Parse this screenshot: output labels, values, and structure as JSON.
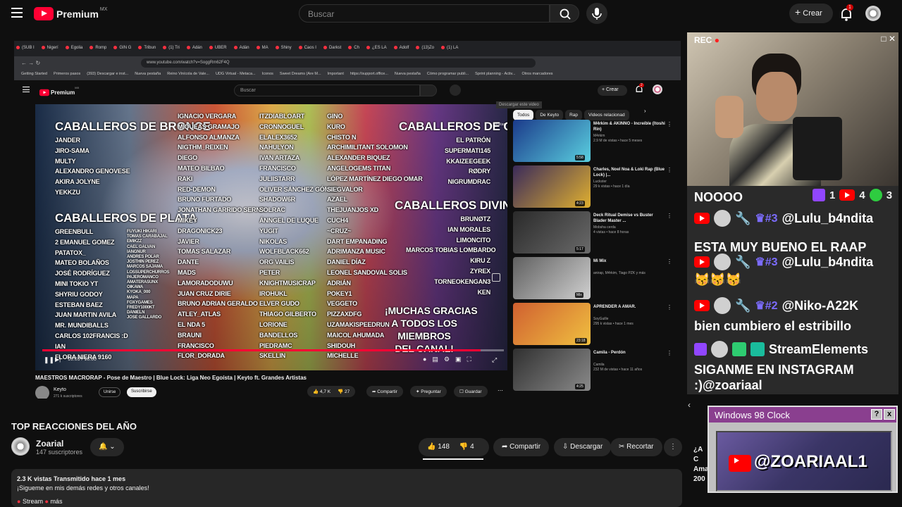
{
  "topbar": {
    "brand": "Premium",
    "region": "MX",
    "search_placeholder": "Buscar",
    "create_label": "Crear",
    "notif_count": "1"
  },
  "browser": {
    "tabs": [
      "(SUB I",
      "Nigerí",
      "Egolia",
      "Romp",
      "GIN G",
      "Tribun",
      "(1) Tri",
      "Adán",
      "UBER",
      "Adán",
      "MA",
      "Shiny",
      "Caos I",
      "Darkst",
      "Ch",
      "¿ES LA",
      "Adolf",
      "(13)Zo",
      "(1) LA"
    ],
    "url": "www.youtube.com/watch?v=SoggRm62F4Q",
    "bookmarks": [
      "Getting Started",
      "Primeros pasos",
      "(393) Descargar e inst...",
      "Nueva pestaña",
      "Reino Vinícola de Vale...",
      "UDG Virtual - Metaca...",
      "Iconos",
      "Sweet Dreams (Are M...",
      "Important",
      "https://support.office...",
      "Nueva pestaña",
      "Cómo programar publi...",
      "Sprint planning - Activ...",
      "Otros marcadores"
    ]
  },
  "inner": {
    "brand": "Premium",
    "region": "MX",
    "search_placeholder": "Buscar",
    "create_label": "Crear",
    "notif": "2",
    "video_title": "MAESTROS MACRORAP - Pose de Maestro | Blue Lock: Liga Neo Egoísta | Keyto ft. Grandes Artistas",
    "channel": "Keyto",
    "subs": "271 k suscriptores",
    "join": "Unirse",
    "subscribe": "Suscribirse",
    "likes": "4,7 K",
    "dislikes": "27",
    "share": "Compartir",
    "ask": "Preguntar",
    "save": "Guardar",
    "time": "16:03 / 18:00",
    "progress": 0.95,
    "chips": [
      "Todos",
      "De Keyto",
      "Rap",
      "Videos relacionad"
    ],
    "tooltip": "Descargar este video",
    "hide": "Ocultar",
    "recos": [
      {
        "title": "M4rkim & AKINNO - Increíble (Itoshi Rin)",
        "channel": "M4rkim",
        "meta": "2.9 M de vistas • hace 5 meses",
        "dur": "5:58",
        "c1": "#1b3a8a",
        "c2": "#5ad0e0"
      },
      {
        "title": "Charles, Noel Noa & Loki Rap (Blue Lock) |...",
        "channel": "Luckster",
        "meta": "29 k vistas • hace 1 día",
        "dur": "4:23",
        "c1": "#3a2a5a",
        "c2": "#e0b030"
      },
      {
        "title": "Deck Ritual Demise vs Buster Blader Master ...",
        "channel": "Mobsha cerda",
        "meta": "4 vistas • hace 8 horas",
        "dur": "5:17",
        "c1": "#2a2a2a",
        "c2": "#6a6a6a"
      },
      {
        "title": "Mi Mix",
        "channel": "anirap, M4rkim, Tiago PZK y más",
        "meta": "",
        "dur": "Mix",
        "c1": "#606060",
        "c2": "#d0d0d0"
      },
      {
        "title": "APRENDER A AMAR.",
        "channel": "SoyGuille",
        "meta": "295 k vistas • hace 1 mes",
        "dur": "23:18",
        "c1": "#d06030",
        "c2": "#f0c040"
      },
      {
        "title": "Camila - Perdón",
        "channel": "Camila",
        "meta": "232 M de vistas • hace 11 años",
        "dur": "4:25",
        "c1": "#303030",
        "c2": "#8a8a8a"
      }
    ],
    "credits": {
      "bronze_head": "CABALLEROS DE BRONCE",
      "bronze": [
        "JANDER",
        "JIRO-SAMA",
        "MULTY",
        "ALEXANDRO GENOVESE",
        "AKIRA JOLYNE",
        "YEKKZU"
      ],
      "plata_head": "CABALLEROS DE PLATA",
      "plata": [
        "GREENBULL",
        "2 EMANUEL GOMEZ",
        "PATATOX_",
        "MATEO BOLAÑOS",
        "JOSÉ RODRÍGUEZ",
        "MINI TOKIO YT",
        "SHYRIU GODOY",
        "ESTEBAN BAEZ",
        "JUAN MARTIN AVILA",
        "MR. MUNDIBALLS",
        "CARLOS 102FRANCIS :D",
        "IAN",
        "FLORA NIERA 9160"
      ],
      "tiny": [
        "FUYUKI HIKARI",
        "TOMAS CARABAJAL",
        "EMIKZZ",
        "CAEL GALVAN",
        "IANGNUR",
        "ANDRES POLAR",
        "JOSTHIN PEREZ",
        "MARCOS SAJAMA",
        "LOSSUPERCHURROS",
        "PAJEROMANCO",
        "AMATERASUNX",
        "OIKAWA",
        "KYOKA_000",
        "MAPA",
        "FOXYGAMES",
        "FREDY1000KT",
        "DANIELN",
        "JOSE GALLARDO"
      ],
      "col2": [
        "IGNACIO VERGARA",
        "MIQUEAS GRAMAJO",
        "ALFONSO ALMANZA",
        "NIGTHM_REIXEN",
        "DIEGO",
        "MATEO BILBAO",
        "RAKI",
        "RED-DEMON",
        "BRUNO FURTADO",
        "JONATHAN GARRIDO SERNA",
        "MIKEY",
        "DRAGONICK23",
        "JAVIER",
        "TOMAS SALAZAR",
        "DANTE",
        "MADS",
        "LAMORADODUWU",
        "JUAN CRUZ DIRIE",
        "BRUNO ADRIAN GERALDO",
        "ATLEY_ATLAS",
        "EL NDA 5",
        "BRAUNI",
        "FRANCISCO",
        "FLOR_DORADA"
      ],
      "col3": [
        "ITZDIABLOART",
        "CRONNOGUEL",
        "ELALEX3652",
        "NAHULYON",
        "IVAN ARTAZA",
        "FRANCISCO",
        "JULIISTARR",
        "OLIVER SÁNCHEZ GÓMEZ",
        "SHADOW6R",
        "SOLRAC",
        "ÁNNGEL DE LUQUE",
        "YUGIT",
        "NIKOLAS",
        "WOLFBLACK662",
        "ORG VAILIS",
        "PETER",
        "KNIGHTMUSICRAP",
        "IROHUKL",
        "ELVER GUDO",
        "THIAGO GILBERTO",
        "LORIONE",
        "BANDELLOS",
        "PIEDRAMC",
        "SKELLIN"
      ],
      "col4": [
        "GINO",
        "KURO",
        "CHISTO N",
        "ARCHIMILITANT SOLOMON",
        "ALEXANDER BIQUEZ",
        "ANGELOGEMS TITAN",
        "LÓPEZ MARTÍNEZ DIEGO OMAR",
        "SIEGVALOR",
        "AZAEL",
        "THEJUANJOS XD",
        "CUCH4",
        "~CRUZ~",
        "DART EMPANADING",
        "ADRIMANZA MUSIC",
        "DANIEL DÍAZ",
        "LEONEL SANDOVAL SOLIS",
        "ADRIÁN",
        "POKEY1",
        "VEGGETO",
        "PIZZAXDFG",
        "UZAMAKISPEEDRUN",
        "MAICOL AHUMADA",
        "SHIDOUH",
        "MICHELLE"
      ],
      "oro_head": "CABALLEROS DE ORO",
      "oro": [
        "EL PATRÓN",
        "SUPERMATI145",
        "KKAIZEEGEEK",
        "RØDRY",
        "NIGRUMDRAC"
      ],
      "div_head": "CABALLEROS DIVINOS",
      "div": [
        "BRUNØTZ",
        "IAN MORALES",
        "LIMONCITO",
        "MARCOS TOBIAS LOMBARDO",
        "KIRU Z",
        "ZYREX",
        "TORNEOKENGAN3",
        "KEN"
      ],
      "thanks": [
        "¡MUCHAS GRACIAS",
        "A TODOS LOS",
        "MIEMBROS",
        "DEL CANAL!"
      ]
    }
  },
  "stream": {
    "rec": "REC"
  },
  "chat": {
    "header": "NOOOO",
    "twitch_count": "1",
    "yt_count": "4",
    "other_count": "3",
    "messages": [
      {
        "user": "@Lulu_b4ndita",
        "badge": "#3",
        "text": "ESTA MUY BUENO EL RAAP"
      },
      {
        "user": "@Lulu_b4ndita",
        "badge": "#3",
        "text": "😽😽😽"
      },
      {
        "user": "@Niko-A22K",
        "badge": "#2",
        "text": "bien cumbiero el estribillo"
      },
      {
        "user": "StreamElements",
        "badge": "",
        "text": "SIGANME EN INSTAGRAM :)@zoariaal"
      }
    ]
  },
  "win98": {
    "title": "Windows 98 Clock",
    "help": "?",
    "close": "x",
    "handle": "@ZOARIAAL1"
  },
  "below": {
    "section_title": "TOP REACCIONES DEL AÑO",
    "channel": "Zoarial",
    "subs": "147 suscriptores",
    "likes": "148",
    "dislikes": "4",
    "share": "Compartir",
    "download": "Descargar",
    "clip": "Recortar",
    "views": "2.3 K vistas  Transmitido hace 1 mes",
    "desc": "¡Sigueme en mis demás redes y otros canales!",
    "more_label": "más",
    "stream_label": "Stream",
    "side_partial": [
      "¿A C",
      "Ama",
      "200"
    ]
  },
  "colors": {
    "accent": "#ff0033",
    "twitch": "#9146ff",
    "win98_title": "#8a3f8f"
  }
}
